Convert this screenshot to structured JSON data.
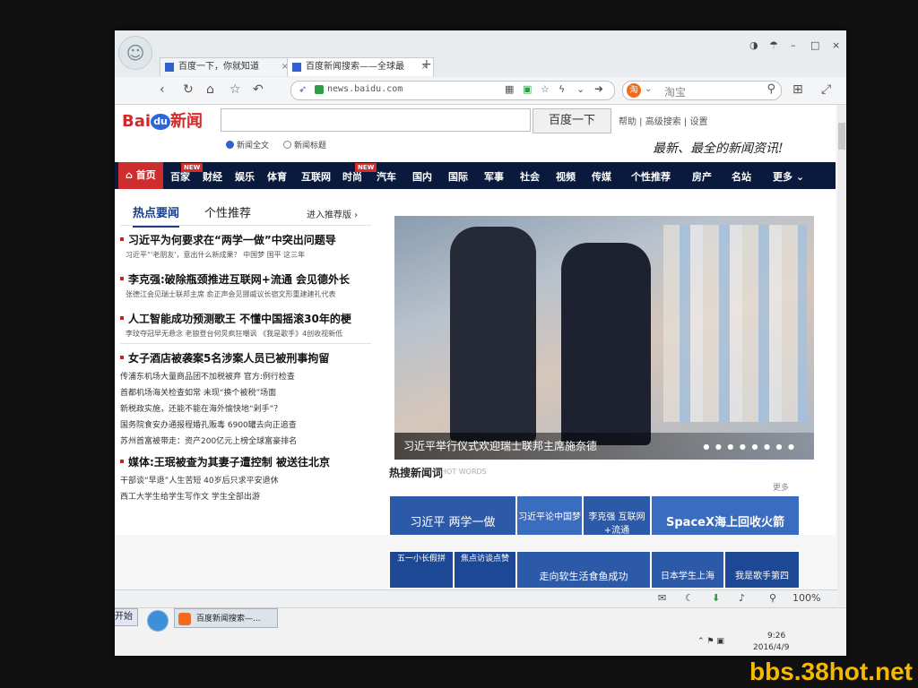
{
  "browser": {
    "tabs": [
      {
        "label": "百度一下，你就知道",
        "active": false
      },
      {
        "label": "百度新闻搜索——全球最",
        "active": true
      }
    ],
    "new_tab": "+",
    "url": "news.baidu.com",
    "search_engine": "淘宝",
    "window_controls": [
      "◑",
      "☂",
      "–",
      "□",
      "×"
    ]
  },
  "baidu": {
    "logo_bai": "Bai",
    "logo_du": "du",
    "logo_news": "新闻",
    "search_button": "百度一下",
    "top_links": "帮助 | 高级搜索 | 设置",
    "radio_all": "新闻全文",
    "radio_title": "新闻标题",
    "slogan": "最新、最全的新闻资讯!",
    "nav": [
      "首页",
      "百家",
      "财经",
      "娱乐",
      "体育",
      "互联网",
      "时尚",
      "汽车",
      "国内",
      "国际",
      "军事",
      "社会",
      "视频",
      "传媒",
      "个性推荐",
      "房产",
      "名站",
      "更多"
    ],
    "nav_badge": "NEW"
  },
  "left": {
    "tab_hot": "热点要闻",
    "tab_personal": "个性推荐",
    "enter_recommend": "进入推荐版",
    "headlines": [
      {
        "title": "习近平为何要求在“两学一做”中突出问题导",
        "sub": "习近平“'老朋友'，意出什么新成果？ 中国梦 国平 这三年"
      },
      {
        "title": "李克强:破除瓶颈推进互联网+流通 会见德外长",
        "sub": "张德江会见瑞士联邦主席 俞正声会见挪威议长宿文形重建建礼代表"
      },
      {
        "title": "人工智能成功预测歌王 不懂中国摇滚30年的梗",
        "sub": "李玟夺冠早无悬念 老狼登台何炅疯狂嘲讽 《我是歌手》4创收视新低"
      },
      {
        "title": "女子酒店被袭案5名涉案人员已被刑事拘留",
        "sub": ""
      }
    ],
    "bullets": [
      "传浦东机场大量商品团不加税被弃 官方:例行检查",
      "首都机场海关检查如常 未现“换个被税”场面",
      "新税政实施，还能不能在海外愉快地“剁手”？",
      "国务院食安办通报程婚孔贩毒 6900罐去向正追查",
      "苏州首富被带走：资产200亿元上榜全球富豪排名"
    ],
    "headline_5": "媒体:王珉被查为其妻子遭控制 被送往北京",
    "bullets_2": [
      "干部谈“早退”人生苦短 40岁后只求平安退休",
      "西工大学生给学生写作文 学生全部出游"
    ]
  },
  "hero": {
    "caption": "习近平举行仪式欢迎瑞士联邦主席施奈德",
    "dots": "● ● ● ● ● ● ● ●"
  },
  "hot": {
    "title": "热搜新闻词",
    "subtitle": "HOT WORDS",
    "more": "更多",
    "tiles": [
      "习近平 两学一做",
      "习近平论中国梦",
      "李克强 互联网+流通",
      "SpaceX海上回收火箭",
      "五一小长假拼",
      "焦点访谈点赞",
      "走向软生活食鱼成功",
      "日本学生上海",
      "我是歌手第四"
    ]
  },
  "status": {
    "zoom": "100%"
  },
  "taskbar": {
    "start": "开始",
    "window": "百度新闻搜索—...",
    "time": "9:26",
    "date": "2016/4/9"
  },
  "watermark": "bbs.38hot.net"
}
